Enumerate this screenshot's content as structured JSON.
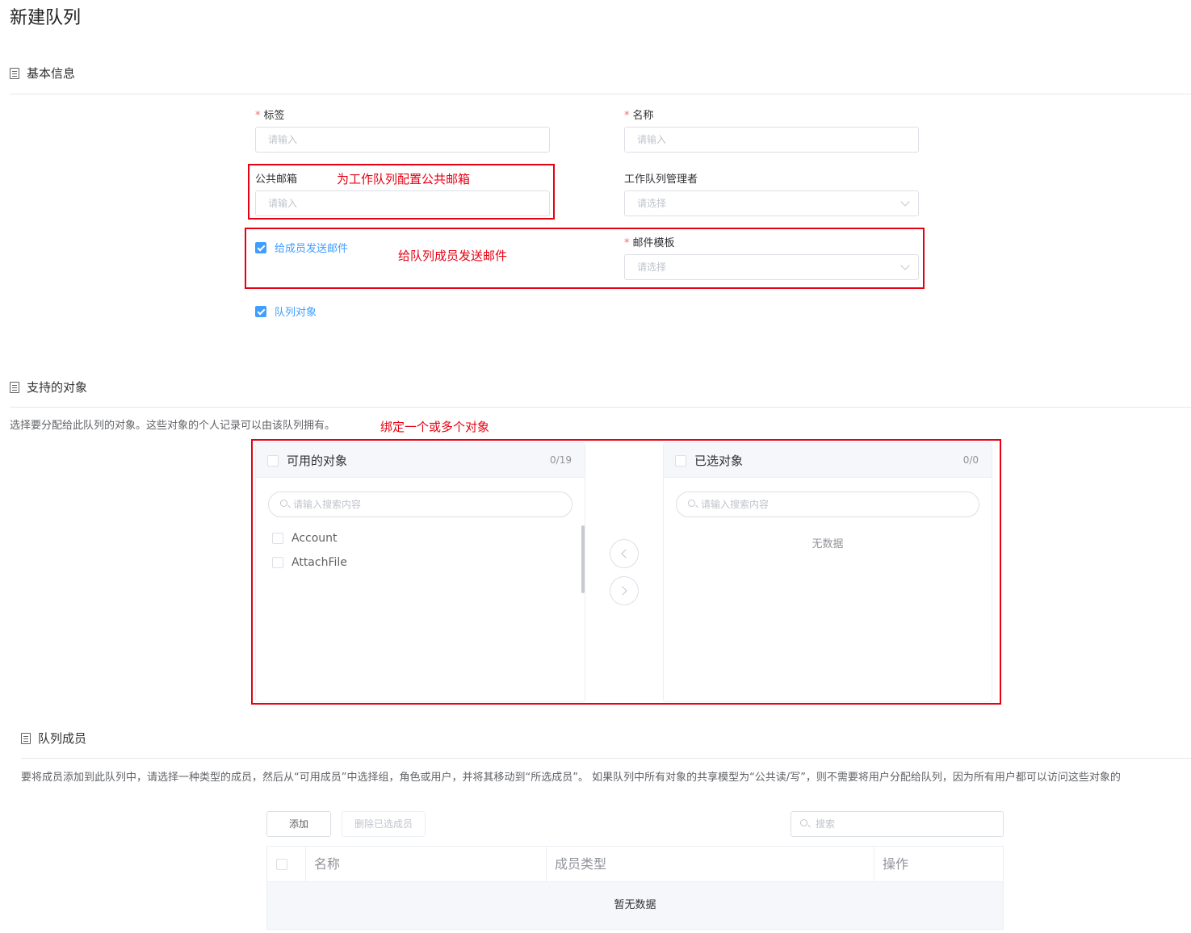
{
  "page": {
    "title": "新建队列"
  },
  "basic": {
    "title": "基本信息",
    "label_field": {
      "label": "标签",
      "placeholder": "请输入"
    },
    "name_field": {
      "label": "名称",
      "placeholder": "请输入"
    },
    "email_field": {
      "label": "公共邮箱",
      "placeholder": "请输入"
    },
    "manager_field": {
      "label": "工作队列管理者",
      "placeholder": "请选择"
    },
    "send_email": {
      "label": "给成员发送邮件",
      "checked": true
    },
    "template_field": {
      "label": "邮件模板",
      "placeholder": "请选择"
    },
    "queue_object": {
      "label": "队列对象",
      "checked": true
    }
  },
  "annotations": {
    "email": "为工作队列配置公共邮箱",
    "send": "给队列成员发送邮件",
    "bind": "绑定一个或多个对象"
  },
  "objects": {
    "title": "支持的对象",
    "description": "选择要分配给此队列的对象。这些对象的个人记录可以由该队列拥有。",
    "available": {
      "title": "可用的对象",
      "count": "0/19",
      "search_placeholder": "请输入搜索内容",
      "items": [
        "Account",
        "AttachFile"
      ]
    },
    "selected": {
      "title": "已选对象",
      "count": "0/0",
      "search_placeholder": "请输入搜索内容",
      "empty": "无数据"
    }
  },
  "members": {
    "title": "队列成员",
    "description": "要将成员添加到此队列中，请选择一种类型的成员，然后从“可用成员”中选择组，角色或用户，并将其移动到“所选成员”。 如果队列中所有对象的共享模型为“公共读/写”，则不需要将用户分配给队列，因为所有用户都可以访问这些对象的",
    "add_button": "添加",
    "delete_button": "删除已选成员",
    "search_placeholder": "搜索",
    "columns": [
      "名称",
      "成员类型",
      "操作"
    ],
    "empty": "暂无数据"
  }
}
